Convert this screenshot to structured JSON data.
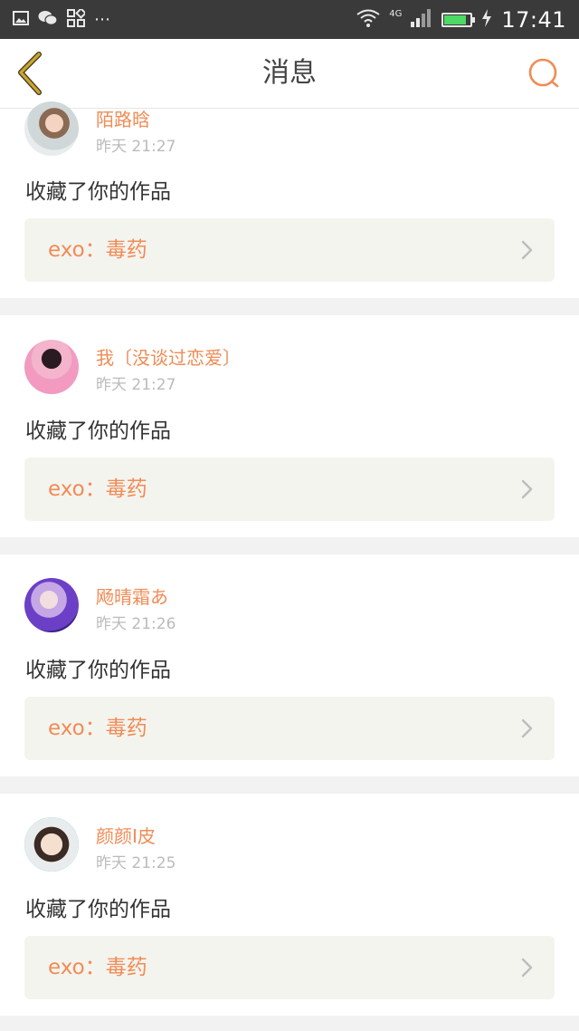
{
  "status_bar": {
    "time": "17:41",
    "network": "4G",
    "more": "⋯",
    "battery_level": 0.85,
    "icons": [
      "image-icon",
      "wechat-icon",
      "app-grid-icon",
      "more-dots-icon",
      "wifi-icon",
      "signal-icon",
      "battery-icon",
      "charging-icon"
    ]
  },
  "header": {
    "title": "消息",
    "back_icon": "chevron-left-icon",
    "search_icon": "search-icon"
  },
  "colors": {
    "accent": "#f08c56",
    "back_arrow": "#c8a52a",
    "text": "#333333",
    "muted": "#bbbbbb",
    "card_box": "#f4f4ef",
    "divider": "#f2f2f2"
  },
  "messages": [
    {
      "user": "陌路晗",
      "time": "昨天 21:27",
      "action": "收藏了你的作品",
      "work": "exo：毒药"
    },
    {
      "user": "我〔没谈过恋爱〕",
      "time": "昨天 21:27",
      "action": "收藏了你的作品",
      "work": "exo：毒药"
    },
    {
      "user": "飏晴霜あ",
      "time": "昨天 21:26",
      "action": "收藏了你的作品",
      "work": "exo：毒药"
    },
    {
      "user": "颜颜I皮",
      "time": "昨天 21:25",
      "action": "收藏了你的作品",
      "work": "exo：毒药"
    }
  ]
}
